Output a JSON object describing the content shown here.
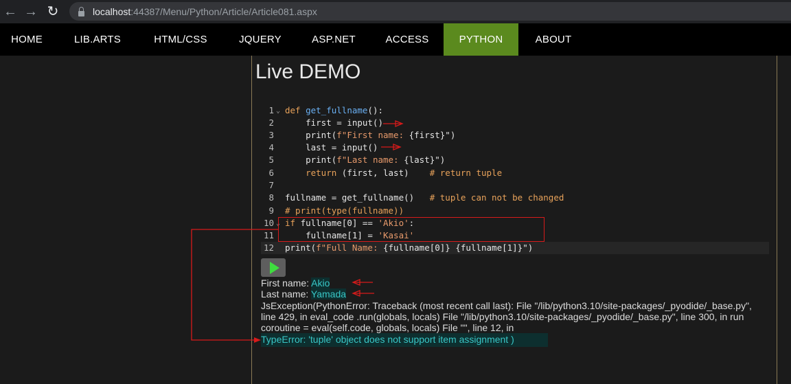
{
  "browser": {
    "back_icon": "arrow-left-icon",
    "forward_icon": "arrow-right-icon",
    "reload_icon": "reload-icon",
    "url_host": "localhost",
    "url_rest": ":44387/Menu/Python/Article/Article081.aspx"
  },
  "nav": {
    "items": [
      {
        "label": "HOME"
      },
      {
        "label": "LIB.ARTS"
      },
      {
        "label": "HTML/CSS"
      },
      {
        "label": "JQUERY"
      },
      {
        "label": "ASP.NET"
      },
      {
        "label": "ACCESS"
      },
      {
        "label": "PYTHON",
        "active": true
      },
      {
        "label": "ABOUT"
      }
    ]
  },
  "page": {
    "title": "Live DEMO"
  },
  "code": {
    "lines": [
      {
        "no": "1",
        "kw": "def ",
        "fn": "get_fullname",
        "text": "():"
      },
      {
        "no": "2",
        "text": "    first = input()"
      },
      {
        "no": "3",
        "pre": "    print(",
        "str": "f\"First name: ",
        "post": "{first}\")"
      },
      {
        "no": "4",
        "text": "    last = input()"
      },
      {
        "no": "5",
        "pre": "    print(",
        "str": "f\"Last name: ",
        "post": "{last}\")"
      },
      {
        "no": "6",
        "kw": "    return",
        "text": " (first, last)    ",
        "cm": "# return tuple"
      },
      {
        "no": "7",
        "text": ""
      },
      {
        "no": "8",
        "text": "fullname = get_fullname()   ",
        "cm": "# tuple can not be changed"
      },
      {
        "no": "9",
        "cm": "# print(type(fullname))"
      },
      {
        "no": "10",
        "kw": "if",
        "text": " fullname[0] == ",
        "str": "'Akio'",
        "post": ":"
      },
      {
        "no": "11",
        "text": "    fullname[1] = ",
        "str": "'Kasai'"
      },
      {
        "no": "12",
        "pre": "print(",
        "str": "f\"Full Name: ",
        "post": "{fullname[0]} {fullname[1]}\")"
      }
    ]
  },
  "run_button": {
    "icon": "play-icon"
  },
  "output": {
    "first_label": "First name: ",
    "first_value": "Akio",
    "last_label": "Last name: ",
    "last_value": "Yamada",
    "exception": "JsException(PythonError: Traceback (most recent call last): File \"/lib/python3.10/site-packages/_pyodide/_base.py\", line 429, in eval_code .run(globals, locals) File \"/lib/python3.10/site-packages/_pyodide/_base.py\", line 300, in run coroutine = eval(self.code, globals, locals) File \"\", line 12, in",
    "type_error": "TypeError: 'tuple' object does not support item assignment )"
  },
  "colors": {
    "nav_active": "#5b8a1e",
    "annotation": "#d81b1b",
    "output_highlight": "#39c6c6"
  }
}
